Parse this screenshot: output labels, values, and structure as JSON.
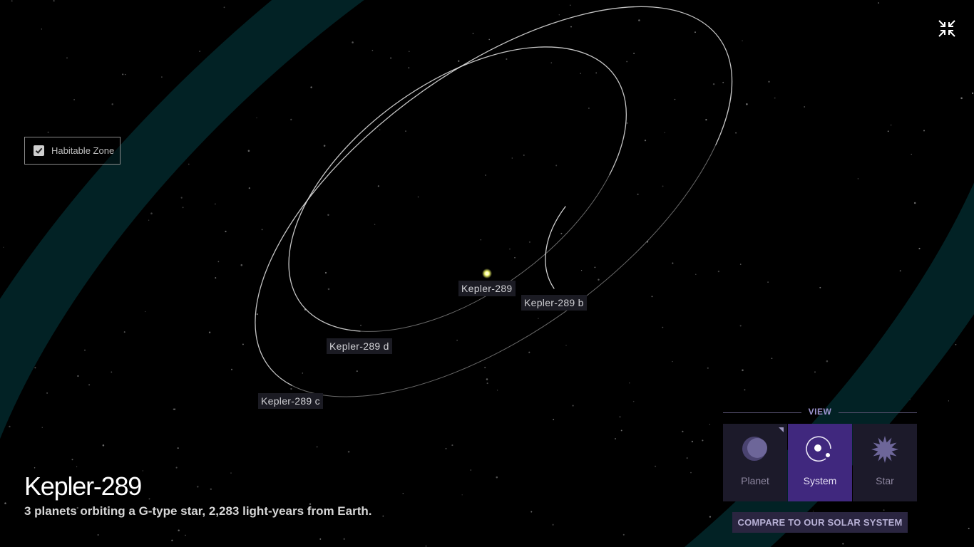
{
  "system": {
    "title": "Kepler-289",
    "subtitle": "3 planets orbiting a G-type star, 2,283 light-years from Earth."
  },
  "habitable_zone_toggle": {
    "label": "Habitable Zone",
    "checked": true
  },
  "labels": {
    "star": "Kepler-289",
    "planet_b": "Kepler-289 b",
    "planet_d": "Kepler-289 d",
    "planet_c": "Kepler-289 c"
  },
  "view_panel": {
    "heading": "VIEW",
    "options": [
      {
        "label": "Planet",
        "icon": "planet-icon",
        "active": false
      },
      {
        "label": "System",
        "icon": "system-icon",
        "active": true
      },
      {
        "label": "Star",
        "icon": "star-icon",
        "active": false
      }
    ]
  },
  "compare_button": {
    "label": "COMPARE TO OUR SOLAR SYSTEM"
  },
  "colors": {
    "background": "#000000",
    "habitable_zone": "#022225",
    "orbit": "#c8c8c8",
    "star": "#f4f96a",
    "view_active": "#40287e",
    "view_inactive": "#1c1a2a"
  }
}
